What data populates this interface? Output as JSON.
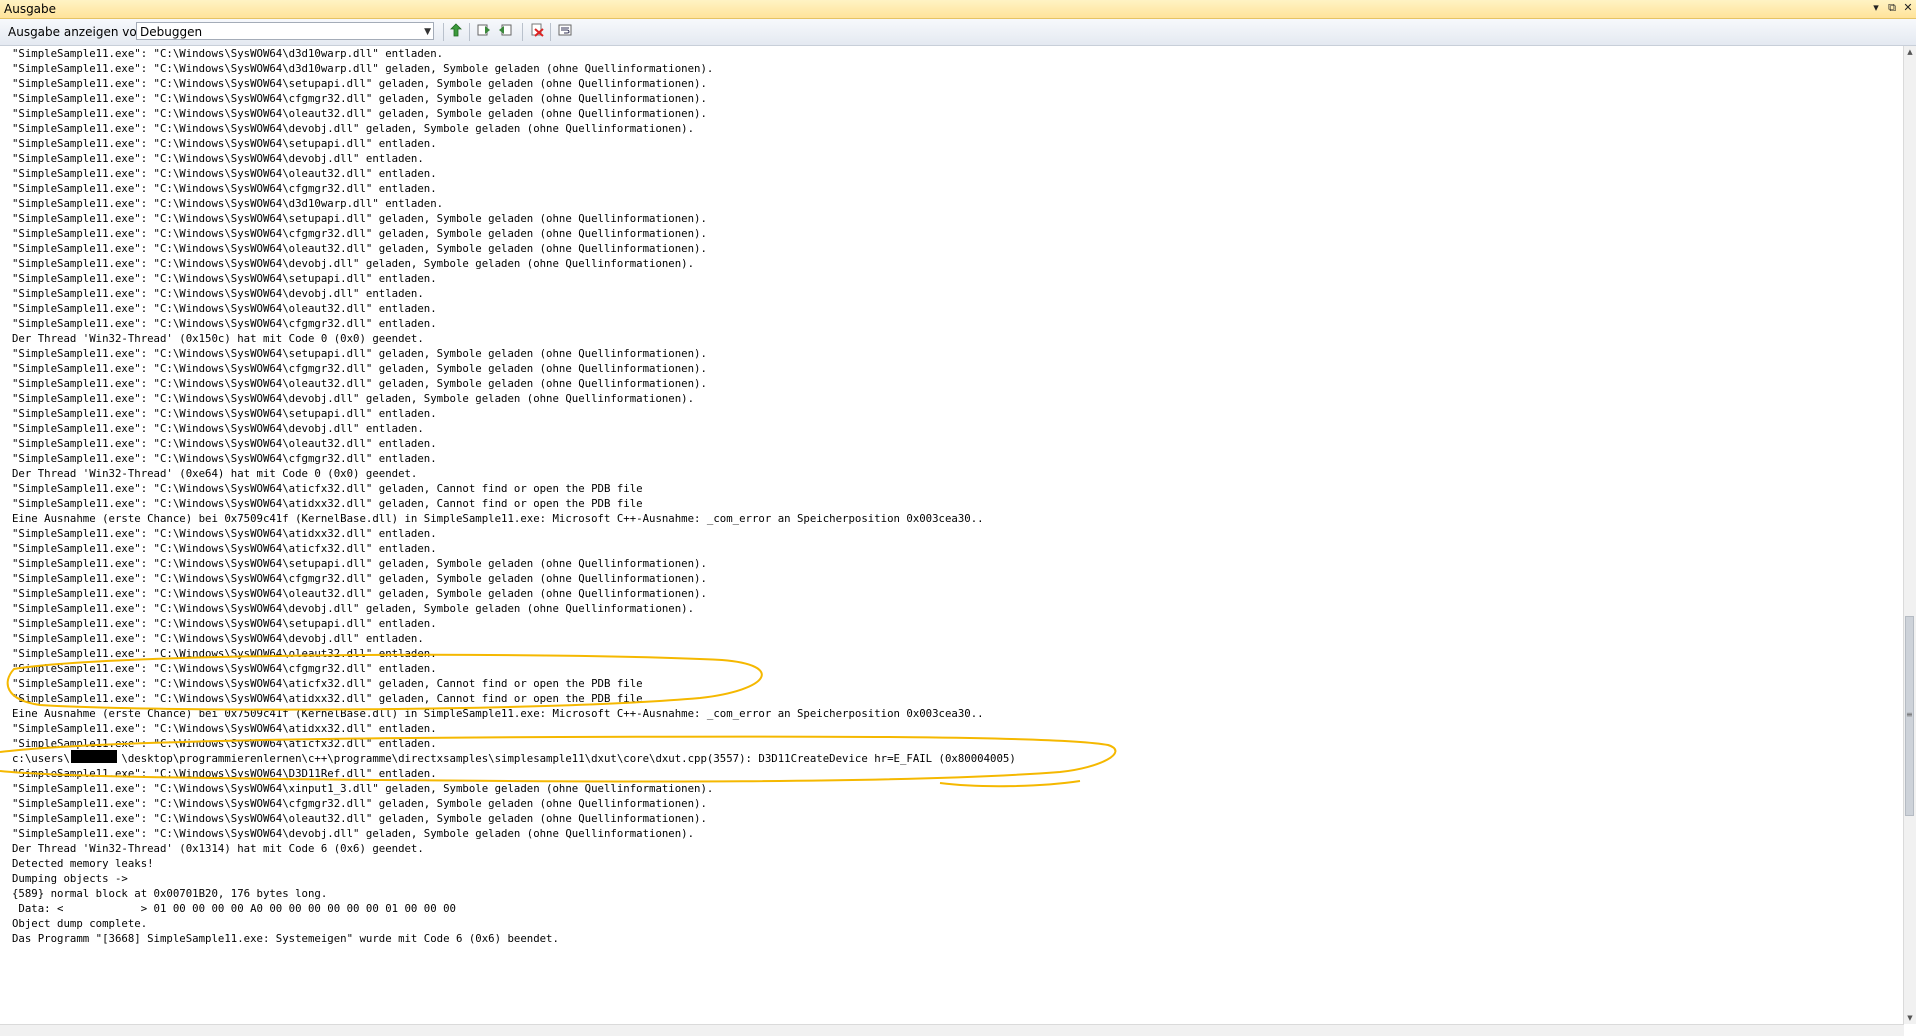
{
  "window": {
    "title": "Ausgabe",
    "controls": [
      "▾",
      "⧉",
      "✕"
    ]
  },
  "toolbar": {
    "label": "Ausgabe anzeigen von:",
    "source_value": "Debuggen",
    "icons": [
      "goto-code-icon",
      "prev-message-icon",
      "next-message-icon",
      "clear-all-icon",
      "word-wrap-icon"
    ]
  },
  "annotation_color": "#f5b800",
  "output": {
    "lines": [
      "\"SimpleSample11.exe\": \"C:\\Windows\\SysWOW64\\d3d10warp.dll\" entladen.",
      "\"SimpleSample11.exe\": \"C:\\Windows\\SysWOW64\\d3d10warp.dll\" geladen, Symbole geladen (ohne Quellinformationen).",
      "\"SimpleSample11.exe\": \"C:\\Windows\\SysWOW64\\setupapi.dll\" geladen, Symbole geladen (ohne Quellinformationen).",
      "\"SimpleSample11.exe\": \"C:\\Windows\\SysWOW64\\cfgmgr32.dll\" geladen, Symbole geladen (ohne Quellinformationen).",
      "\"SimpleSample11.exe\": \"C:\\Windows\\SysWOW64\\oleaut32.dll\" geladen, Symbole geladen (ohne Quellinformationen).",
      "\"SimpleSample11.exe\": \"C:\\Windows\\SysWOW64\\devobj.dll\" geladen, Symbole geladen (ohne Quellinformationen).",
      "\"SimpleSample11.exe\": \"C:\\Windows\\SysWOW64\\setupapi.dll\" entladen.",
      "\"SimpleSample11.exe\": \"C:\\Windows\\SysWOW64\\devobj.dll\" entladen.",
      "\"SimpleSample11.exe\": \"C:\\Windows\\SysWOW64\\oleaut32.dll\" entladen.",
      "\"SimpleSample11.exe\": \"C:\\Windows\\SysWOW64\\cfgmgr32.dll\" entladen.",
      "\"SimpleSample11.exe\": \"C:\\Windows\\SysWOW64\\d3d10warp.dll\" entladen.",
      "\"SimpleSample11.exe\": \"C:\\Windows\\SysWOW64\\setupapi.dll\" geladen, Symbole geladen (ohne Quellinformationen).",
      "\"SimpleSample11.exe\": \"C:\\Windows\\SysWOW64\\cfgmgr32.dll\" geladen, Symbole geladen (ohne Quellinformationen).",
      "\"SimpleSample11.exe\": \"C:\\Windows\\SysWOW64\\oleaut32.dll\" geladen, Symbole geladen (ohne Quellinformationen).",
      "\"SimpleSample11.exe\": \"C:\\Windows\\SysWOW64\\devobj.dll\" geladen, Symbole geladen (ohne Quellinformationen).",
      "\"SimpleSample11.exe\": \"C:\\Windows\\SysWOW64\\setupapi.dll\" entladen.",
      "\"SimpleSample11.exe\": \"C:\\Windows\\SysWOW64\\devobj.dll\" entladen.",
      "\"SimpleSample11.exe\": \"C:\\Windows\\SysWOW64\\oleaut32.dll\" entladen.",
      "\"SimpleSample11.exe\": \"C:\\Windows\\SysWOW64\\cfgmgr32.dll\" entladen.",
      "Der Thread 'Win32-Thread' (0x150c) hat mit Code 0 (0x0) geendet.",
      "\"SimpleSample11.exe\": \"C:\\Windows\\SysWOW64\\setupapi.dll\" geladen, Symbole geladen (ohne Quellinformationen).",
      "\"SimpleSample11.exe\": \"C:\\Windows\\SysWOW64\\cfgmgr32.dll\" geladen, Symbole geladen (ohne Quellinformationen).",
      "\"SimpleSample11.exe\": \"C:\\Windows\\SysWOW64\\oleaut32.dll\" geladen, Symbole geladen (ohne Quellinformationen).",
      "\"SimpleSample11.exe\": \"C:\\Windows\\SysWOW64\\devobj.dll\" geladen, Symbole geladen (ohne Quellinformationen).",
      "\"SimpleSample11.exe\": \"C:\\Windows\\SysWOW64\\setupapi.dll\" entladen.",
      "\"SimpleSample11.exe\": \"C:\\Windows\\SysWOW64\\devobj.dll\" entladen.",
      "\"SimpleSample11.exe\": \"C:\\Windows\\SysWOW64\\oleaut32.dll\" entladen.",
      "\"SimpleSample11.exe\": \"C:\\Windows\\SysWOW64\\cfgmgr32.dll\" entladen.",
      "Der Thread 'Win32-Thread' (0xe64) hat mit Code 0 (0x0) geendet.",
      "\"SimpleSample11.exe\": \"C:\\Windows\\SysWOW64\\aticfx32.dll\" geladen, Cannot find or open the PDB file",
      "\"SimpleSample11.exe\": \"C:\\Windows\\SysWOW64\\atidxx32.dll\" geladen, Cannot find or open the PDB file",
      "Eine Ausnahme (erste Chance) bei 0x7509c41f (KernelBase.dll) in SimpleSample11.exe: Microsoft C++-Ausnahme: _com_error an Speicherposition 0x003cea30..",
      "\"SimpleSample11.exe\": \"C:\\Windows\\SysWOW64\\atidxx32.dll\" entladen.",
      "\"SimpleSample11.exe\": \"C:\\Windows\\SysWOW64\\aticfx32.dll\" entladen.",
      "\"SimpleSample11.exe\": \"C:\\Windows\\SysWOW64\\setupapi.dll\" geladen, Symbole geladen (ohne Quellinformationen).",
      "\"SimpleSample11.exe\": \"C:\\Windows\\SysWOW64\\cfgmgr32.dll\" geladen, Symbole geladen (ohne Quellinformationen).",
      "\"SimpleSample11.exe\": \"C:\\Windows\\SysWOW64\\oleaut32.dll\" geladen, Symbole geladen (ohne Quellinformationen).",
      "\"SimpleSample11.exe\": \"C:\\Windows\\SysWOW64\\devobj.dll\" geladen, Symbole geladen (ohne Quellinformationen).",
      "\"SimpleSample11.exe\": \"C:\\Windows\\SysWOW64\\setupapi.dll\" entladen.",
      "\"SimpleSample11.exe\": \"C:\\Windows\\SysWOW64\\devobj.dll\" entladen.",
      "\"SimpleSample11.exe\": \"C:\\Windows\\SysWOW64\\oleaut32.dll\" entladen.",
      "\"SimpleSample11.exe\": \"C:\\Windows\\SysWOW64\\cfgmgr32.dll\" entladen.",
      "\"SimpleSample11.exe\": \"C:\\Windows\\SysWOW64\\aticfx32.dll\" geladen, Cannot find or open the PDB file",
      "\"SimpleSample11.exe\": \"C:\\Windows\\SysWOW64\\atidxx32.dll\" geladen, Cannot find or open the PDB file",
      "Eine Ausnahme (erste Chance) bei 0x7509c41f (KernelBase.dll) in SimpleSample11.exe: Microsoft C++-Ausnahme: _com_error an Speicherposition 0x003cea30..",
      "\"SimpleSample11.exe\": \"C:\\Windows\\SysWOW64\\atidxx32.dll\" entladen.",
      "\"SimpleSample11.exe\": \"C:\\Windows\\SysWOW64\\aticfx32.dll\" entladen.",
      "c:\\users\\        \\desktop\\programmierenlernen\\c++\\programme\\directxsamples\\simplesample11\\dxut\\core\\dxut.cpp(3557): D3D11CreateDevice hr=E_FAIL (0x80004005)",
      "\"SimpleSample11.exe\": \"C:\\Windows\\SysWOW64\\D3D11Ref.dll\" entladen.",
      "\"SimpleSample11.exe\": \"C:\\Windows\\SysWOW64\\xinput1_3.dll\" geladen, Symbole geladen (ohne Quellinformationen).",
      "\"SimpleSample11.exe\": \"C:\\Windows\\SysWOW64\\cfgmgr32.dll\" geladen, Symbole geladen (ohne Quellinformationen).",
      "\"SimpleSample11.exe\": \"C:\\Windows\\SysWOW64\\oleaut32.dll\" geladen, Symbole geladen (ohne Quellinformationen).",
      "\"SimpleSample11.exe\": \"C:\\Windows\\SysWOW64\\devobj.dll\" geladen, Symbole geladen (ohne Quellinformationen).",
      "Der Thread 'Win32-Thread' (0x1314) hat mit Code 6 (0x6) geendet.",
      "Detected memory leaks!",
      "Dumping objects ->",
      "{589} normal block at 0x00701B20, 176 bytes long.",
      " Data: <            > 01 00 00 00 00 A0 00 00 00 00 00 00 01 00 00 00",
      "Object dump complete.",
      "Das Programm \"[3668] SimpleSample11.exe: Systemeigen\" wurde mit Code 6 (0x6) beendet."
    ]
  }
}
